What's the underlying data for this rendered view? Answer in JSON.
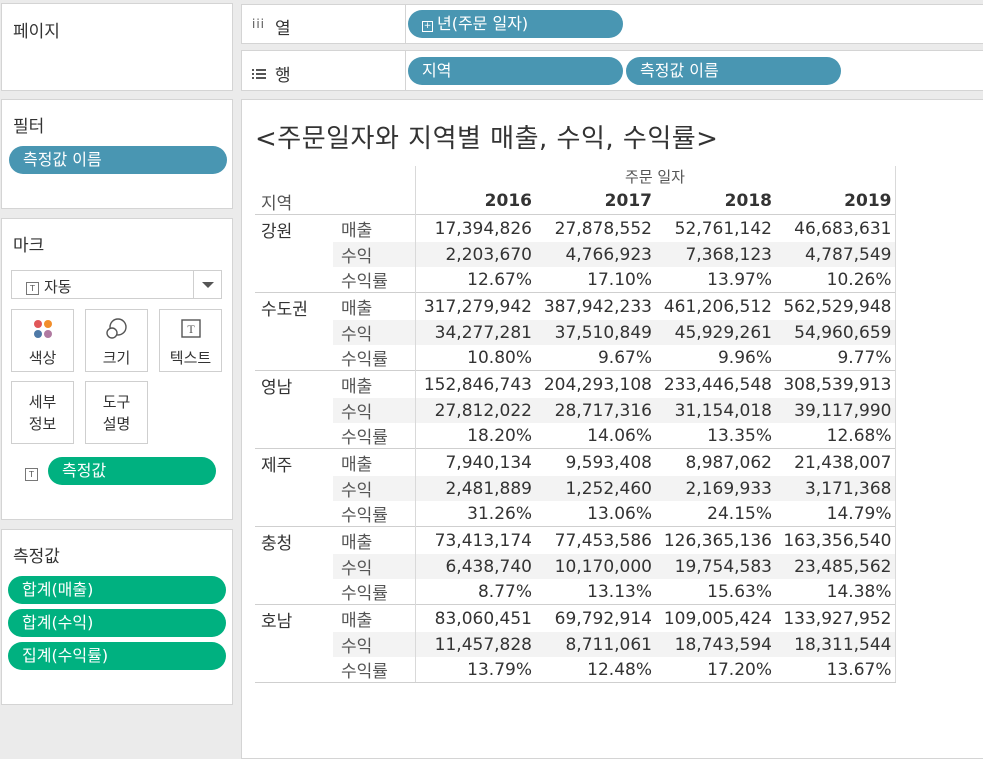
{
  "pages_card": {
    "title": "페이지"
  },
  "filters_card": {
    "title": "필터",
    "pill": "측정값 이름"
  },
  "marks_card": {
    "title": "마크",
    "mark_type": "자동",
    "buttons": {
      "color": "색상",
      "size": "크기",
      "text": "텍스트",
      "detail_1": "세부",
      "detail_2": "정보",
      "tooltip_1": "도구",
      "tooltip_2": "설명"
    },
    "text_pill": "측정값"
  },
  "measures_card": {
    "title": "측정값",
    "pills": [
      "합계(매출)",
      "합계(수익)",
      "집계(수익률)"
    ]
  },
  "shelves": {
    "columns_label": "열",
    "columns_pill": "년(주문 일자)",
    "rows_label": "행",
    "rows_pill_1": "지역",
    "rows_pill_2": "측정값 이름"
  },
  "view": {
    "title": "<주문일자와 지역별 매출, 수익, 수익률>",
    "column_header_group": "주문 일자",
    "row_header_label": "지역",
    "years": [
      "2016",
      "2017",
      "2018",
      "2019"
    ],
    "measures": [
      "매출",
      "수익",
      "수익률"
    ]
  },
  "chart_data": {
    "type": "table",
    "title": "<주문일자와 지역별 매출, 수익, 수익률>",
    "columns": [
      "2016",
      "2017",
      "2018",
      "2019"
    ],
    "rows": [
      {
        "region": "강원",
        "values": [
          [
            "17,394,826",
            "27,878,552",
            "52,761,142",
            "46,683,631"
          ],
          [
            "2,203,670",
            "4,766,923",
            "7,368,123",
            "4,787,549"
          ],
          [
            "12.67%",
            "17.10%",
            "13.97%",
            "10.26%"
          ]
        ]
      },
      {
        "region": "수도권",
        "values": [
          [
            "317,279,942",
            "387,942,233",
            "461,206,512",
            "562,529,948"
          ],
          [
            "34,277,281",
            "37,510,849",
            "45,929,261",
            "54,960,659"
          ],
          [
            "10.80%",
            "9.67%",
            "9.96%",
            "9.77%"
          ]
        ]
      },
      {
        "region": "영남",
        "values": [
          [
            "152,846,743",
            "204,293,108",
            "233,446,548",
            "308,539,913"
          ],
          [
            "27,812,022",
            "28,717,316",
            "31,154,018",
            "39,117,990"
          ],
          [
            "18.20%",
            "14.06%",
            "13.35%",
            "12.68%"
          ]
        ]
      },
      {
        "region": "제주",
        "values": [
          [
            "7,940,134",
            "9,593,408",
            "8,987,062",
            "21,438,007"
          ],
          [
            "2,481,889",
            "1,252,460",
            "2,169,933",
            "3,171,368"
          ],
          [
            "31.26%",
            "13.06%",
            "24.15%",
            "14.79%"
          ]
        ]
      },
      {
        "region": "충청",
        "values": [
          [
            "73,413,174",
            "77,453,586",
            "126,365,136",
            "163,356,540"
          ],
          [
            "6,438,740",
            "10,170,000",
            "19,754,583",
            "23,485,562"
          ],
          [
            "8.77%",
            "13.13%",
            "15.63%",
            "14.38%"
          ]
        ]
      },
      {
        "region": "호남",
        "values": [
          [
            "83,060,451",
            "69,792,914",
            "109,005,424",
            "133,927,952"
          ],
          [
            "11,457,828",
            "8,711,061",
            "18,743,594",
            "18,311,544"
          ],
          [
            "13.79%",
            "12.48%",
            "17.20%",
            "13.67%"
          ]
        ]
      }
    ]
  },
  "colors": {
    "dimension_pill": "#4996b2",
    "measure_pill": "#00b180",
    "background": "#ebebeb"
  }
}
